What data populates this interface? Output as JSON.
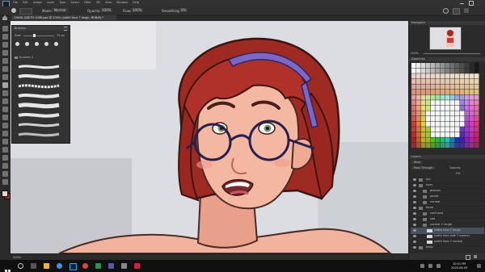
{
  "menu": {
    "items": [
      "File",
      "Edit",
      "Image",
      "Layer",
      "Type",
      "Select",
      "Filter",
      "3D",
      "View",
      "Window",
      "Help"
    ]
  },
  "options": {
    "mode_label": "Mode:",
    "mode_value": "Normal",
    "opacity_label": "Opacity:",
    "opacity_value": "100%",
    "flow_label": "Flow:",
    "flow_value": "100%",
    "smoothing_label": "Smoothing:",
    "smoothing_value": "0%"
  },
  "document_tab": "CHARL JUDITH 1008.psd @ 200% (Judith face 7 laugh, RGB/8) *",
  "brushes_panel": {
    "title": "Brushes",
    "size_label": "Size:",
    "size_value": "74 px",
    "group_label": "brushes 1"
  },
  "right": {
    "navigator_title": "Navigator",
    "navigator_zoom": "200%",
    "swatches_title": "Swatches",
    "layers_title": "Layers",
    "search_placeholder": "Kind",
    "blend_mode": "Pass Through",
    "opacity_label": "Opacity:",
    "fill_label": "Fill:",
    "layers": [
      {
        "name": "out",
        "kind": "folder",
        "indent": 0
      },
      {
        "name": "eyes",
        "kind": "folder",
        "indent": 0
      },
      {
        "name": "glasses",
        "kind": "folder",
        "indent": 1
      },
      {
        "name": "jacket",
        "kind": "folder",
        "indent": 1
      },
      {
        "name": "normal",
        "kind": "folder",
        "indent": 1
      },
      {
        "name": "faces",
        "kind": "folder",
        "indent": 0
      },
      {
        "name": "confused",
        "kind": "folder",
        "indent": 1
      },
      {
        "name": "sad",
        "kind": "folder",
        "indent": 1
      },
      {
        "name": "normal + laugh",
        "kind": "folder",
        "indent": 1
      },
      {
        "name": "judith face 7 laugh",
        "kind": "layer",
        "indent": 2,
        "selected": true
      },
      {
        "name": "judith face side 7 normal",
        "kind": "layer",
        "indent": 2
      },
      {
        "name": "judith face 7 normal",
        "kind": "layer",
        "indent": 2
      },
      {
        "name": "body",
        "kind": "folder",
        "indent": 0
      }
    ]
  },
  "status": {
    "zoom": "200%"
  },
  "taskbar": {
    "time": "10:01 PM",
    "date": "2020-06-09"
  }
}
